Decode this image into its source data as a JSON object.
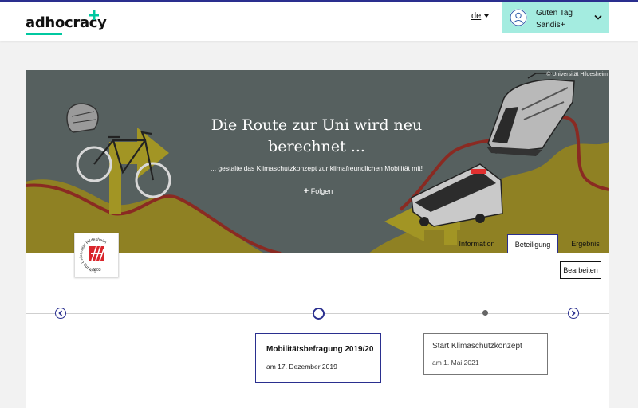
{
  "brand": {
    "logo_text": "adhocracy",
    "plus_color": "#00c8a0",
    "underline_color": "#00c8a0",
    "accent": "#2a2f8f"
  },
  "header": {
    "language": "de",
    "user": {
      "greeting": "Guten Tag",
      "name": "Sandis+",
      "bg_color": "#a4ece0"
    }
  },
  "project": {
    "image_credit": "© Universität Hildesheim",
    "title": "Die Route zur Uni wird neu berechnet ...",
    "subtitle": "... gestalte das Klimaschutzkonzept zur klimafreundlichen Mobilität mit!",
    "follow_label": "Folgen",
    "tabs": [
      {
        "label": "Information",
        "active": false
      },
      {
        "label": "Beteiligung",
        "active": true
      },
      {
        "label": "Ergebnis",
        "active": false
      }
    ],
    "edit_label": "Bearbeiten",
    "emblem": {
      "text_ring": "Stiftung Universität Hildesheim",
      "year": "2003",
      "color": "#d9252b"
    }
  },
  "timeline": {
    "phases": [
      {
        "title": "Mobilitätsbefragung 2019/20",
        "date": "am 17. Dezember 2019",
        "active": true
      },
      {
        "title": "Start Klimaschutzkonzept",
        "date": "am 1. Mai 2021",
        "active": false
      }
    ]
  }
}
